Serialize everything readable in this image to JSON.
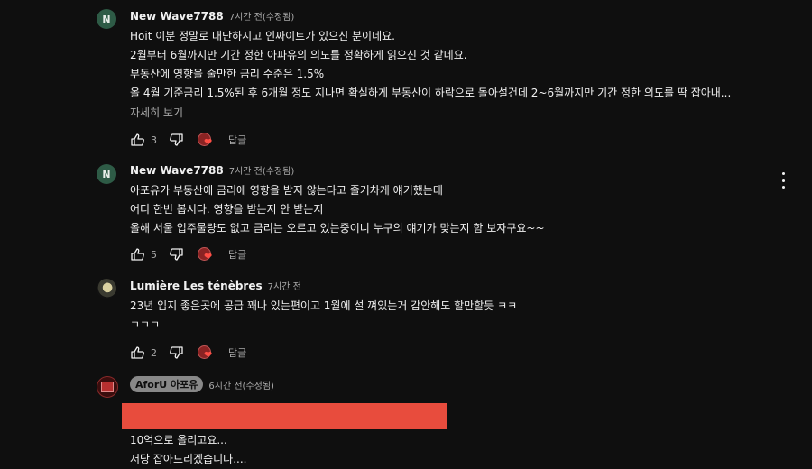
{
  "comments": [
    {
      "avatar_letter": "N",
      "author": "New Wave7788",
      "time": "7시간 전(수정됨)",
      "lines": [
        "Hoit 이분 정말로 대단하시고 인싸이트가 있으신 분이네요.",
        "2월부터 6월까지만 기간 정한 아파유의 의도를 정확하게 읽으신 것 같네요.",
        "부동산에 영향을 줄만한 금리 수준은 1.5%",
        "올 4월 기준금리 1.5%된 후 6개월 정도 지나면 확실하게 부동산이 하락으로 돌아설건데 2~6월까지만 기간 정한 의도를 딱 잡아내..."
      ],
      "more": "자세히 보기",
      "likes": "3",
      "reply": "답글"
    },
    {
      "avatar_letter": "N",
      "author": "New Wave7788",
      "time": "7시간 전(수정됨)",
      "lines": [
        "아포유가  부동산에 금리에 영향을 받지 않는다고 줄기차게 얘기했는데",
        "어디 한번 봅시다. 영향을 받는지 안 받는지",
        "올해 서울 입주물량도 없고 금리는 오르고 있는중이니 누구의 얘기가 맞는지 함 보자구요~~"
      ],
      "likes": "5",
      "reply": "답글"
    },
    {
      "author": "Lumière Les ténèbres",
      "time": "7시간 전",
      "lines": [
        "23년 입지 좋은곳에 공급 꽤나 있는편이고 1월에 설 껴있는거 감안해도 할만할듯 ㅋㅋ",
        "ㄱㄱㄱ"
      ],
      "likes": "2",
      "reply": "답글"
    },
    {
      "author": "AforU 아포유",
      "time": "6시간 전(수정됨)",
      "lines": [
        "10억으로 올리고요...",
        "저당 잡아드리겠습니다...."
      ]
    }
  ],
  "colors": {
    "background": "#0f0f0f",
    "text": "#f1f1f1",
    "secondary": "#aaaaaa",
    "heart": "#ff4e45",
    "redaction": "#e84c3d",
    "avatar_n": "#2e5b46"
  },
  "icons": [
    "thumb-up-icon",
    "thumb-down-icon",
    "creator-heart-icon",
    "more-vert-icon"
  ]
}
